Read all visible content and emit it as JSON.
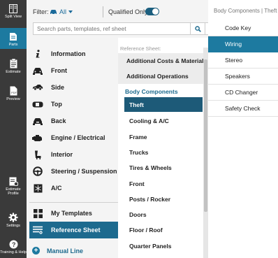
{
  "rail": {
    "items": [
      {
        "label": "Split View",
        "icon": "split-view-icon"
      },
      {
        "label": "Parts",
        "icon": "parts-icon"
      },
      {
        "label": "Estimate",
        "icon": "estimate-icon"
      },
      {
        "label": "Preview",
        "icon": "preview-icon"
      },
      {
        "label": "Estimate Profile",
        "icon": "estimate-profile-icon"
      },
      {
        "label": "Settings",
        "icon": "gear-icon"
      },
      {
        "label": "Training & Help",
        "icon": "help-icon"
      }
    ]
  },
  "filter": {
    "label": "Filter:",
    "selected": "All",
    "qualified_label": "Qualified Only",
    "qualified_on": true
  },
  "search": {
    "placeholder": "Search parts, templates, ref sheet"
  },
  "categories": [
    {
      "label": "Information",
      "icon": "info-icon"
    },
    {
      "label": "Front",
      "icon": "car-front-icon"
    },
    {
      "label": "Side",
      "icon": "car-side-icon"
    },
    {
      "label": "Top",
      "icon": "car-top-icon"
    },
    {
      "label": "Back",
      "icon": "car-back-icon"
    },
    {
      "label": "Engine / Electrical",
      "icon": "engine-icon"
    },
    {
      "label": "Interior",
      "icon": "seat-icon"
    },
    {
      "label": "Steering / Suspension",
      "icon": "steering-icon"
    },
    {
      "label": "A/C",
      "icon": "ac-icon"
    }
  ],
  "lower_nav": [
    {
      "label": "My Templates",
      "icon": "templates-icon"
    },
    {
      "label": "Reference Sheet",
      "icon": "reference-sheet-icon"
    }
  ],
  "manual_line": "Manual Line",
  "reference": {
    "header": "Reference Sheet:",
    "top_items": [
      "Additional Costs & Materials",
      "Additional Operations"
    ],
    "group_label": "Body Components",
    "items": [
      "Theft",
      "Cooling & A/C",
      "Frame",
      "Trucks",
      "Tires & Wheels",
      "Front",
      "Posts / Rocker",
      "Doors",
      "Floor / Roof",
      "Quarter Panels"
    ],
    "selected": "Theft"
  },
  "right": {
    "breadcrumb": "Body Components | Theft",
    "items": [
      "Code Key",
      "Wiring",
      "Stereo",
      "Speakers",
      "CD Changer",
      "Safety Check"
    ],
    "selected": "Wiring"
  },
  "colors": {
    "accent": "#1d7aa0",
    "dark_accent": "#1d5a78",
    "rail_bg": "#3a3a3a"
  }
}
